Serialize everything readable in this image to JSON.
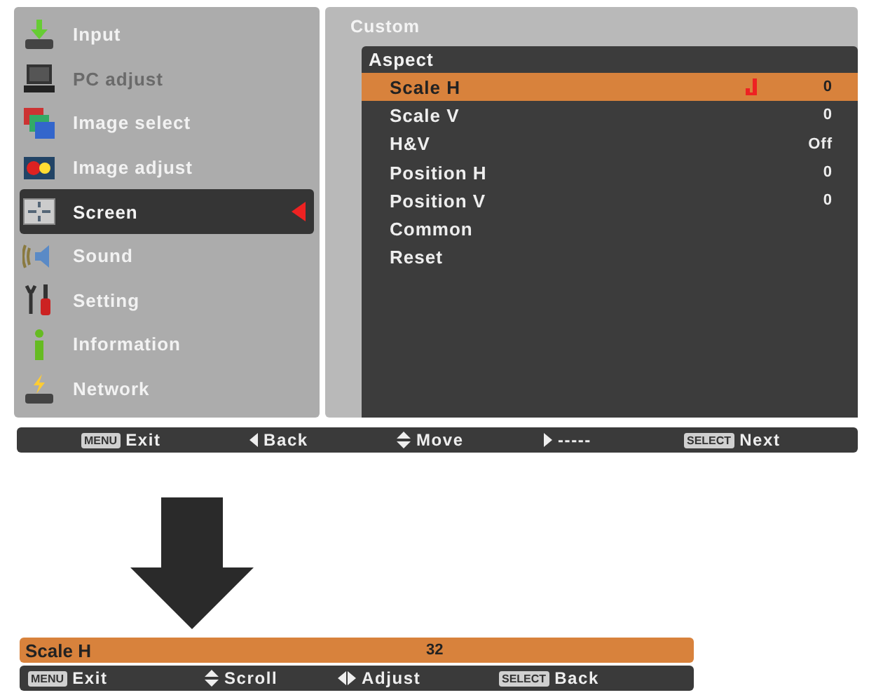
{
  "main_menu": {
    "items": [
      {
        "label": "Input",
        "kind": "input",
        "disabled": false,
        "selected": false
      },
      {
        "label": "PC adjust",
        "kind": "pc",
        "disabled": true,
        "selected": false
      },
      {
        "label": "Image select",
        "kind": "image-select",
        "disabled": false,
        "selected": false
      },
      {
        "label": "Image adjust",
        "kind": "image-adjust",
        "disabled": false,
        "selected": false
      },
      {
        "label": "Screen",
        "kind": "screen",
        "disabled": false,
        "selected": true
      },
      {
        "label": "Sound",
        "kind": "sound",
        "disabled": false,
        "selected": false
      },
      {
        "label": "Setting",
        "kind": "setting",
        "disabled": false,
        "selected": false
      },
      {
        "label": "Information",
        "kind": "information",
        "disabled": false,
        "selected": false
      },
      {
        "label": "Network",
        "kind": "network",
        "disabled": false,
        "selected": false
      }
    ]
  },
  "submenu": {
    "title": "Custom",
    "heading": "Aspect",
    "items": [
      {
        "label": "Scale H",
        "value": "0",
        "selected": true
      },
      {
        "label": "Scale V",
        "value": "0",
        "selected": false
      },
      {
        "label": "H&V",
        "value": "Off",
        "selected": false
      },
      {
        "label": "Position H",
        "value": "0",
        "selected": false
      },
      {
        "label": "Position V",
        "value": "0",
        "selected": false
      },
      {
        "label": "Common",
        "selected": false
      },
      {
        "label": "Reset",
        "selected": false
      }
    ]
  },
  "hint_bar": [
    {
      "kind": "key",
      "key": "MENU",
      "label": "Exit"
    },
    {
      "kind": "left",
      "label": "Back"
    },
    {
      "kind": "updown",
      "label": "Move"
    },
    {
      "kind": "right",
      "label": "-----"
    },
    {
      "kind": "key",
      "key": "SELECT",
      "label": "Next"
    }
  ],
  "adjust_bar": {
    "label": "Scale H",
    "value": "32"
  },
  "adjust_hint_bar": [
    {
      "kind": "key",
      "key": "MENU",
      "label": "Exit"
    },
    {
      "kind": "updown",
      "label": "Scroll"
    },
    {
      "kind": "leftright",
      "label": "Adjust"
    },
    {
      "kind": "key",
      "key": "SELECT",
      "label": "Back"
    }
  ]
}
